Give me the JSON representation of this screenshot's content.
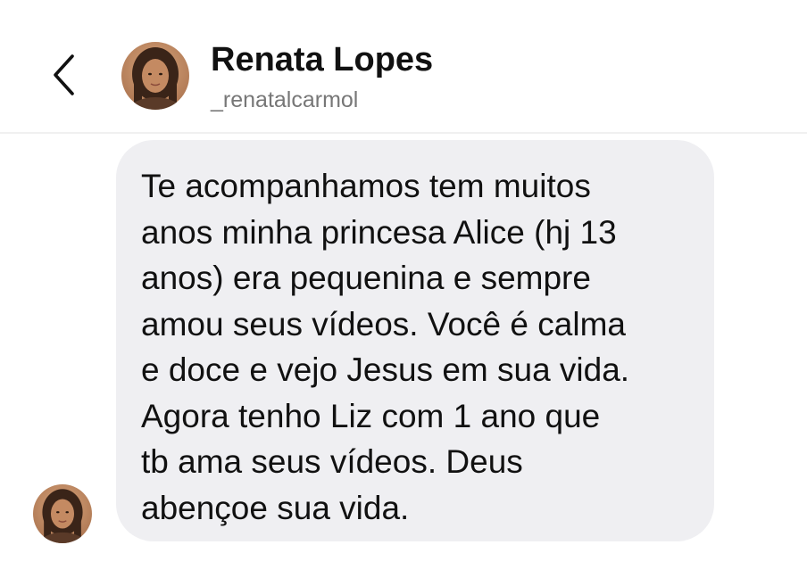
{
  "header": {
    "contact_name": "Renata Lopes",
    "contact_handle": "_renatalcarmol",
    "back_icon": "chevron-left-icon"
  },
  "conversation": {
    "messages": [
      {
        "direction": "incoming",
        "text": "Te acompanhamos tem muitos\nanos minha princesa Alice (hj 13\nanos) era pequenina e sempre\namou seus vídeos. Você é calma\ne doce e vejo Jesus em sua vida.\nAgora tenho   Liz com 1 ano que\ntb ama seus vídeos. Deus\nabençoe sua vida."
      }
    ]
  },
  "colors": {
    "background": "#ffffff",
    "bubble": "#efeff2",
    "text": "#111111",
    "handle": "#777777"
  }
}
